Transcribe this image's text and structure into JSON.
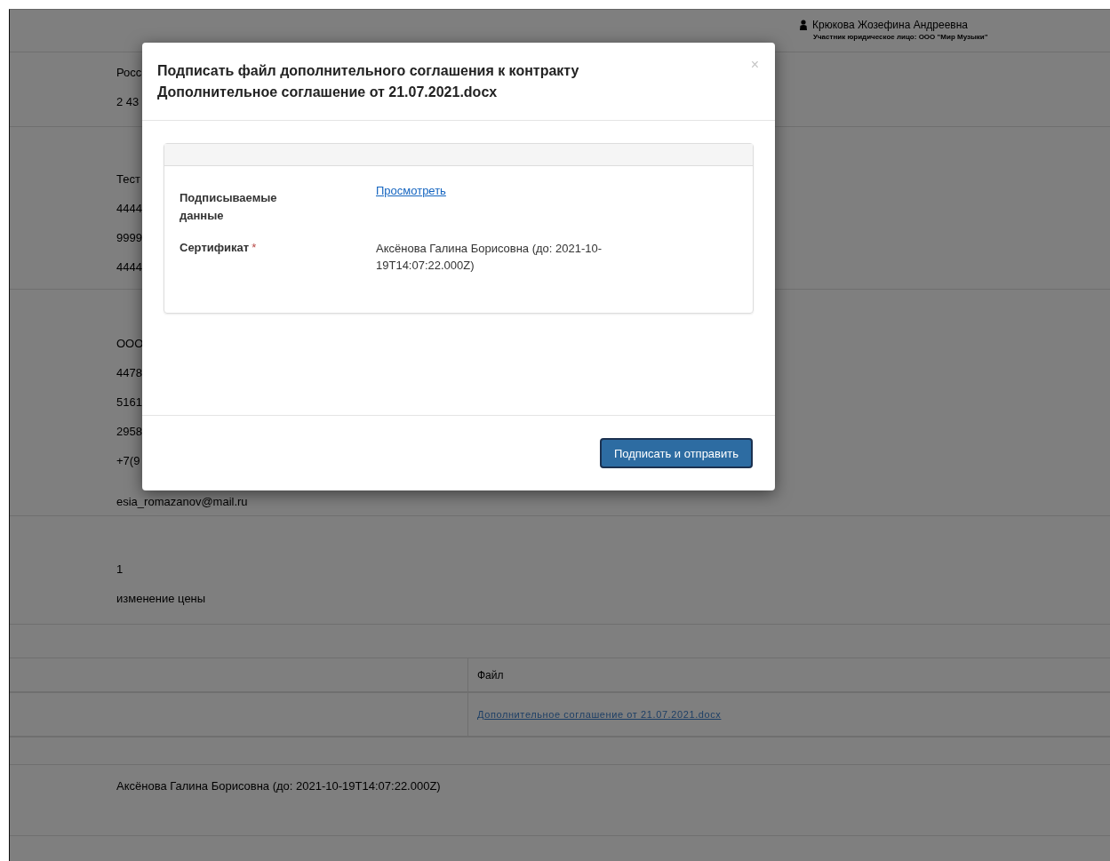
{
  "header": {
    "user_name": "Крюкова Жозефина Андреевна",
    "user_role": "Участник юридическое лицо: ООО \"Мир Музыки\""
  },
  "sections": [
    {
      "lines": [
        "Росс",
        "2 43"
      ]
    },
    {
      "lines": [
        "Тест",
        "4444",
        "9999",
        "4444"
      ]
    },
    {
      "lines": [
        "ООО",
        "4478",
        "5161",
        "2958",
        "+7(9",
        "esia_romazanov@mail.ru"
      ]
    },
    {
      "lines": [
        "1",
        "изменение цены"
      ]
    }
  ],
  "files_table": {
    "column_2": "Файл",
    "rows": [
      {
        "file": "Дополнительное соглашение от 21.07.2021.docx"
      }
    ]
  },
  "signer": "Аксёнова Галина Борисовна (до: 2021-10-19T14:07:22.000Z)",
  "modal": {
    "title_lines": [
      "Подписать файл дополнительного соглашения к контракту",
      "Дополнительное соглашение от 21.07.2021.docx"
    ],
    "close": "×",
    "fields": [
      {
        "label": "Подписываемые данные",
        "kind": "link",
        "value": "Просмотреть"
      },
      {
        "label": "Сертификат",
        "required_mark": "*",
        "kind": "text",
        "value": "Аксёнова Галина Борисовна (до: 2021-10-19T14:07:22.000Z)"
      }
    ],
    "submit": "Подписать и отправить"
  }
}
